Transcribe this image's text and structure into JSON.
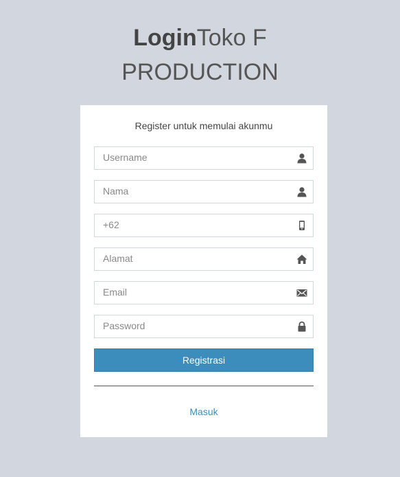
{
  "header": {
    "title_bold": "Login",
    "title_light": "Toko F",
    "title_line2": "PRODUCTION"
  },
  "form": {
    "message": "Register untuk memulai akunmu",
    "fields": [
      {
        "placeholder": "Username",
        "value": "",
        "icon": "user-icon"
      },
      {
        "placeholder": "Nama",
        "value": "",
        "icon": "user-icon"
      },
      {
        "placeholder": "+62",
        "value": "",
        "icon": "phone-icon"
      },
      {
        "placeholder": "Alamat",
        "value": "",
        "icon": "home-icon"
      },
      {
        "placeholder": "Email",
        "value": "",
        "icon": "envelope-icon"
      },
      {
        "placeholder": "Password",
        "value": "",
        "icon": "lock-icon"
      }
    ],
    "submit_label": "Registrasi",
    "login_link": "Masuk"
  },
  "colors": {
    "background": "#d2d6de",
    "primary": "#3c8dbc",
    "icon": "#555555"
  }
}
